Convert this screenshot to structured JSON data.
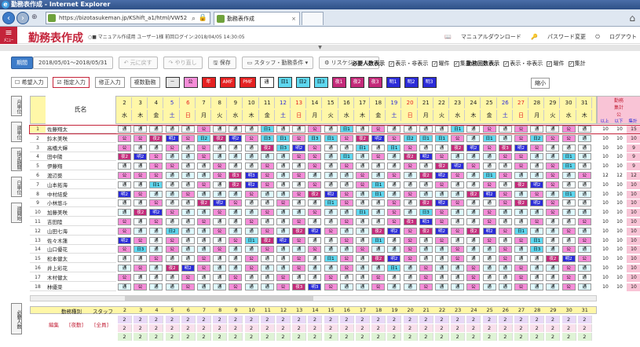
{
  "browser": {
    "window_title": "勤務表作成 - Internet Explorer",
    "url": "https://bizotasukeman.jp/KShift_a1/html/VW52",
    "tab1": "勤務表作成",
    "tab2": ""
  },
  "app": {
    "menu": "ﾒﾆｭｰ",
    "title": "勤務表作成",
    "user_info": "○■ マニュアル作成用 ユーザー1様 前回ログイン:2018/04/05 14:30:05",
    "links": [
      "マニュアルダウンロード",
      "パスワード変更",
      "ログアウト"
    ]
  },
  "toolbar": {
    "period_btn": "期間",
    "period": "2018/05/01～2018/05/31",
    "undo": "元に戻す",
    "redo": "やり直し",
    "save": "保存",
    "staff_cond": "スタッフ・勤務条件",
    "reschedule": "リスケジュール",
    "need_count": "必要人数表示",
    "show_hide": "表示・非表示",
    "kyoken": "曜件",
    "shuukei": "集計",
    "workgroup": "勤務回数表示",
    "show_hide2": "表示・非表示",
    "kyoken2": "曜件",
    "shuukei2": "集計"
  },
  "toolbar2": {
    "buttons": [
      "希望入力",
      "指定入力",
      "修正入力",
      "複数勤務"
    ],
    "legend": [
      {
        "t": "－",
        "bg": "#e6e6e6",
        "fg": "#000"
      },
      {
        "t": "公",
        "bg": "#f58dd8",
        "fg": "#000"
      },
      {
        "t": "年",
        "bg": "#e52222",
        "fg": "#fff"
      },
      {
        "t": "AMF",
        "bg": "#e52222",
        "fg": "#fff"
      },
      {
        "t": "PMF",
        "bg": "#e52222",
        "fg": "#fff"
      },
      {
        "t": "通",
        "bg": "#fff",
        "fg": "#000"
      },
      {
        "t": "日1",
        "bg": "#5fd8f0",
        "fg": "#000"
      },
      {
        "t": "日2",
        "bg": "#5fd8f0",
        "fg": "#000"
      },
      {
        "t": "日3",
        "bg": "#5fd8f0",
        "fg": "#000"
      },
      {
        "t": "夜1",
        "bg": "#c42a7a",
        "fg": "#fff"
      },
      {
        "t": "夜2",
        "bg": "#c42a7a",
        "fg": "#fff"
      },
      {
        "t": "夜3",
        "bg": "#c42a7a",
        "fg": "#fff"
      },
      {
        "t": "明1",
        "bg": "#2b2bd8",
        "fg": "#fff"
      },
      {
        "t": "明2",
        "bg": "#2b2bd8",
        "fg": "#fff"
      },
      {
        "t": "明3",
        "bg": "#2b2bd8",
        "fg": "#fff"
      }
    ],
    "shrink": "縮小"
  },
  "left_buttons": [
    "月単位",
    "週単位",
    "指定期間",
    "日単位",
    "週開始"
  ],
  "sheet_label": "必要人数",
  "grid": {
    "name_header": "氏名",
    "days": [
      "2",
      "3",
      "4",
      "5",
      "6",
      "7",
      "8",
      "9",
      "10",
      "11",
      "12",
      "13",
      "14",
      "15",
      "16",
      "17",
      "18",
      "19",
      "20",
      "21",
      "22",
      "23",
      "24",
      "25",
      "26",
      "27",
      "28",
      "29",
      "30",
      "31"
    ],
    "weekdays": [
      "水",
      "木",
      "金",
      "土",
      "日",
      "月",
      "火",
      "水",
      "木",
      "金",
      "土",
      "日",
      "月",
      "火",
      "水",
      "木",
      "金",
      "土",
      "日",
      "月",
      "火",
      "水",
      "木",
      "金",
      "土",
      "日",
      "月",
      "火",
      "水",
      "木"
    ],
    "summary_header": "勤務",
    "summary_sub": "集計",
    "summary_sub2": "公",
    "summary_cols": [
      "以上",
      "以下",
      "集計"
    ],
    "rows": [
      {
        "n": "1",
        "name": "佐藤翔太",
        "cells": "通通通通通公通通通日1通通公通日1通公通通通通日1通公通公通通公通",
        "tot": [
          "10",
          "10",
          "15"
        ]
      },
      {
        "n": "2",
        "name": "鈴木美咲",
        "cells": "公公夜2明2公日2夜2明2公日3日1公日3日1公夜2明2公日2日1日1公通日1通公日2公公通",
        "tot": [
          "10",
          "10",
          "10"
        ]
      },
      {
        "n": "3",
        "name": "高橋大輝",
        "cells": "公通通公通公通通通夜2日3明2公通通日1通日1公通通夜2明2公夜3明2公通通通",
        "tot": [
          "10",
          "10",
          "9"
        ]
      },
      {
        "n": "4",
        "name": "田中陽",
        "cells": "夜2明2公通通公通通通通通公公通日1通公通夜2明2公通通通公公通通日1通",
        "tot": [
          "10",
          "10",
          "9"
        ]
      },
      {
        "n": "5",
        "name": "伊藤翔",
        "cells": "通通公公通通公通通公通通公通公通通通公通夜2明2公通通公通公日1通",
        "tot": [
          "10",
          "10",
          "9"
        ]
      },
      {
        "n": "6",
        "name": "渡辺葵",
        "cells": "公公公通通通公夜3明3公通公通通通公通公通夜2明2公通日1公通通公通公",
        "tot": [
          "12",
          "12",
          "12"
        ]
      },
      {
        "n": "7",
        "name": "山本拓海",
        "cells": "通通日1通通公通夜2明2公通通公通通公日1通通通公通通公通夜2明2公通通",
        "tot": [
          "10",
          "10",
          "10"
        ]
      },
      {
        "n": "8",
        "name": "中村結愛",
        "cells": "明2公通通公通通通公通通公夜2明2公通日1通公通通通夜2明2公通公通日1通",
        "tot": [
          "10",
          "10",
          "10"
        ]
      },
      {
        "n": "9",
        "name": "小林悠斗",
        "cells": "通通公通通夜2明2公通通公通通日1公通通公通夜2明2公通通公夜2明2公通通",
        "tot": [
          "10",
          "10",
          "10"
        ]
      },
      {
        "n": "10",
        "name": "加藤美咲",
        "cells": "通夜2明2公通通公通通公通通公通通日1通公通日3公通通公通通通公通通",
        "tot": [
          "10",
          "10",
          "10"
        ]
      },
      {
        "n": "11",
        "name": "吉田陸",
        "cells": "公通公通通公通通公通通公通通公通通公夜3明3公通通公通通公通通公",
        "tot": [
          "10",
          "10",
          "10"
        ]
      },
      {
        "n": "12",
        "name": "山田七海",
        "cells": "公通通日2通通公通通公通夜2明2公通通夜2明2公夜2明2公夜2明2公日1通通公通",
        "tot": [
          "10",
          "10",
          "10"
        ]
      },
      {
        "n": "13",
        "name": "佐々木蓮",
        "cells": "明2公通公通通通公日1夜2明2公通通公通日1通公通公通通公通公日1通通公",
        "tot": [
          "10",
          "10",
          "10"
        ]
      },
      {
        "n": "14",
        "name": "山口優花",
        "cells": "公日3通公通通公通通公通通公通通公通通公通通公通通公通日3通公通",
        "tot": [
          "10",
          "10",
          "10"
        ]
      },
      {
        "n": "15",
        "name": "松本健太",
        "cells": "通通公通通公通通公通通公通日1公通夜2明2公通通公通通公通通夜2明2公",
        "tot": [
          "10",
          "10",
          "10"
        ]
      },
      {
        "n": "16",
        "name": "井上彩花",
        "cells": "通公通夜2明2公通通公通通公通通公通通日1通公通通公通通公通通公通",
        "tot": [
          "10",
          "10",
          "10"
        ]
      },
      {
        "n": "17",
        "name": "木村健太",
        "cells": "公通通通公通通公通通公通通公通通公通通公通通公通通公通通公通",
        "tot": [
          "10",
          "10",
          "10"
        ]
      },
      {
        "n": "18",
        "name": "林優菜",
        "cells": "通公通通公通通公通通公夜3明3公通通公通通公通通公通通公通通公通",
        "tot": [
          "10",
          "10",
          "10"
        ]
      }
    ]
  },
  "bottom": {
    "h1": "勤務種別",
    "h2": "スタッフ",
    "r1a": "編集",
    "r1b": "[夜勤]",
    "r1c": "[全員]",
    "values": [
      "2",
      "2",
      "2",
      "2",
      "2",
      "2",
      "2",
      "2",
      "2",
      "2",
      "2",
      "2",
      "2",
      "2",
      "2",
      "2",
      "2",
      "2",
      "2",
      "2",
      "2",
      "2",
      "2",
      "2",
      "2",
      "2",
      "2",
      "2",
      "2",
      "2"
    ]
  },
  "colors": {
    "brand": "#c4243a",
    "pink": "#f58dd8",
    "cyan": "#5fd8f0",
    "night": "#c42a7a",
    "blue": "#2b2bd8",
    "red": "#e52222",
    "yellow": "#fff7a8"
  }
}
